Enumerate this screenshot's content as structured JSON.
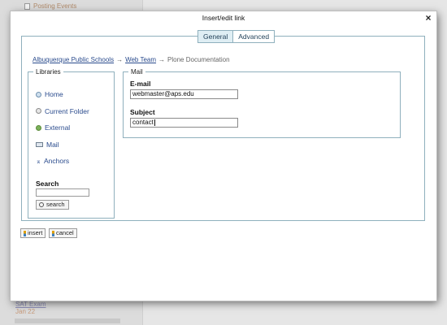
{
  "background": {
    "top_link": "Posting Events",
    "bottom_link": "SAT Exam",
    "bottom_date": "Jan 22"
  },
  "dialog": {
    "title": "Insert/edit link",
    "close_label": "×",
    "tabs": [
      {
        "label": "General",
        "active": true
      },
      {
        "label": "Advanced",
        "active": false
      }
    ],
    "breadcrumb": {
      "items": [
        "Albuquerque Public Schools",
        "Web Team"
      ],
      "current": "Plone Documentation",
      "separator": "→"
    },
    "libraries": {
      "legend": "Libraries",
      "items": [
        {
          "label": "Home",
          "icon": "home-icon"
        },
        {
          "label": "Current Folder",
          "icon": "folder-icon"
        },
        {
          "label": "External",
          "icon": "globe-icon"
        },
        {
          "label": "Mail",
          "icon": "mail-icon"
        },
        {
          "label": "Anchors",
          "icon": "anchor-icon"
        }
      ],
      "search_label": "Search",
      "search_value": "",
      "search_button": "search"
    },
    "mail": {
      "legend": "Mail",
      "email_label": "E-mail",
      "email_value": "webmaster@aps.edu",
      "subject_label": "Subject",
      "subject_value": "contact"
    },
    "buttons": {
      "insert": "insert",
      "cancel": "cancel"
    }
  }
}
